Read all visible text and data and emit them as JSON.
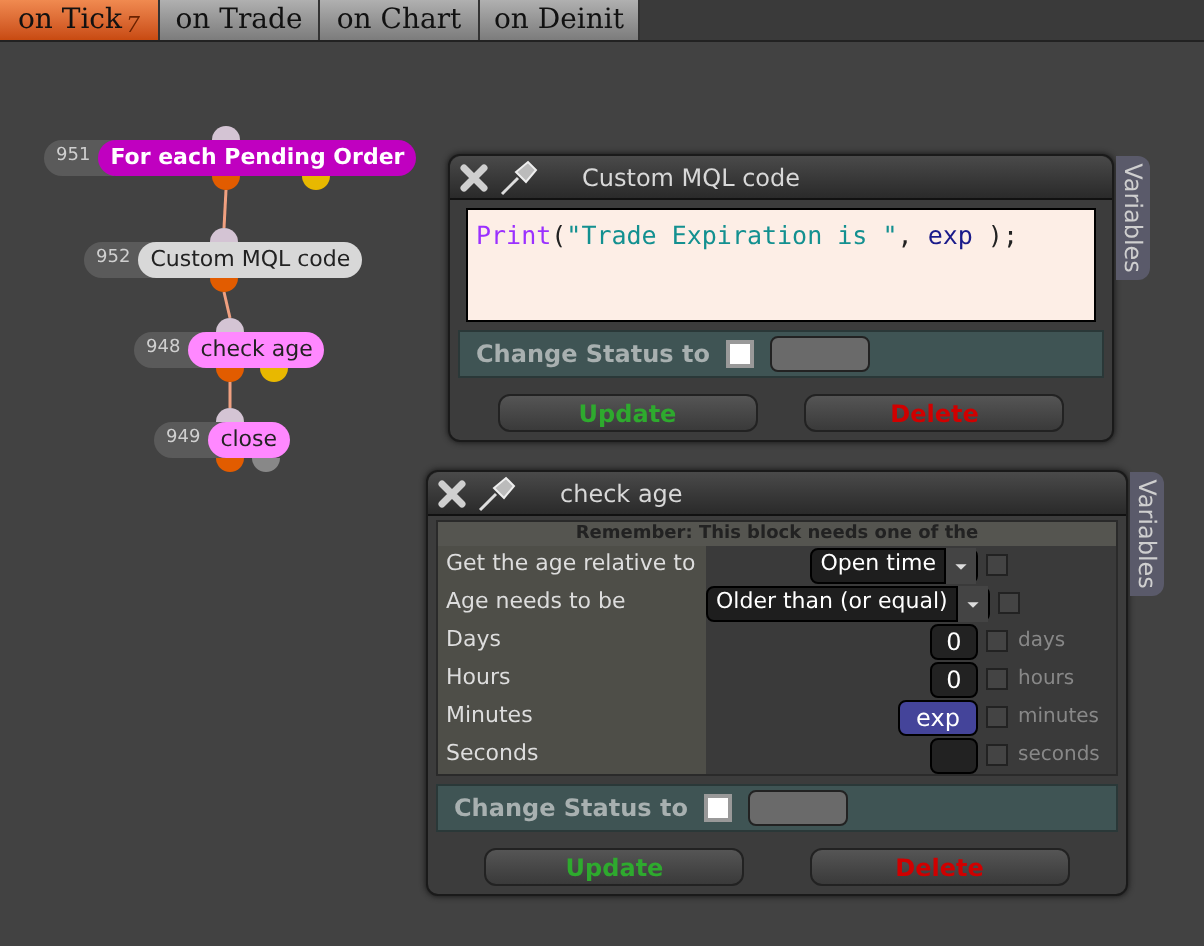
{
  "tabs": [
    {
      "label": "on Tick",
      "badge": "7",
      "selected": true
    },
    {
      "label": "on Trade",
      "selected": false
    },
    {
      "label": "on Chart",
      "selected": false
    },
    {
      "label": "on Deinit",
      "selected": false
    }
  ],
  "nodes": [
    {
      "number": "951",
      "label": "For each Pending Order",
      "kind": "loop",
      "color": "#c000c0"
    },
    {
      "number": "952",
      "label": "Custom MQL code",
      "kind": "code",
      "color": "#d8d8d8"
    },
    {
      "number": "948",
      "label": "check age",
      "kind": "condition",
      "color": "#ff88ff"
    },
    {
      "number": "949",
      "label": "close",
      "kind": "action",
      "color": "#ff88ff"
    }
  ],
  "panels": [
    {
      "title": "Custom MQL code",
      "side_tab": "Variables",
      "code": [
        {
          "kind": "function",
          "text": "Print"
        },
        {
          "kind": "punct",
          "text": "("
        },
        {
          "kind": "string",
          "text": "\"Trade Expiration is \""
        },
        {
          "kind": "punct",
          "text": ", "
        },
        {
          "kind": "variable",
          "text": "exp"
        },
        {
          "kind": "punct",
          "text": " );"
        }
      ],
      "status": {
        "label": "Change Status to",
        "checked": false
      },
      "buttons": [
        {
          "label": "Update",
          "kind": "confirm"
        },
        {
          "label": "Delete",
          "kind": "danger"
        }
      ]
    },
    {
      "title": "check age",
      "side_tab": "Variables",
      "notice": "Remember: This block needs one of the",
      "rows": [
        {
          "label": "Get the age relative to",
          "kind": "select",
          "value": "Open time",
          "variable": false
        },
        {
          "label": "Age needs to be",
          "kind": "select",
          "value": "Older than (or equal)",
          "variable": false
        },
        {
          "label": "Days",
          "kind": "number",
          "value": "0",
          "unit": "days",
          "variable": false
        },
        {
          "label": "Hours",
          "kind": "number",
          "value": "0",
          "unit": "hours",
          "variable": false
        },
        {
          "label": "Minutes",
          "kind": "variable",
          "value": "exp",
          "unit": "minutes",
          "variable": false
        },
        {
          "label": "Seconds",
          "kind": "number",
          "unit": "seconds",
          "variable": false
        }
      ],
      "status": {
        "label": "Change Status to",
        "checked": false
      },
      "buttons": [
        {
          "label": "Update",
          "kind": "confirm"
        },
        {
          "label": "Delete",
          "kind": "danger"
        }
      ]
    }
  ]
}
